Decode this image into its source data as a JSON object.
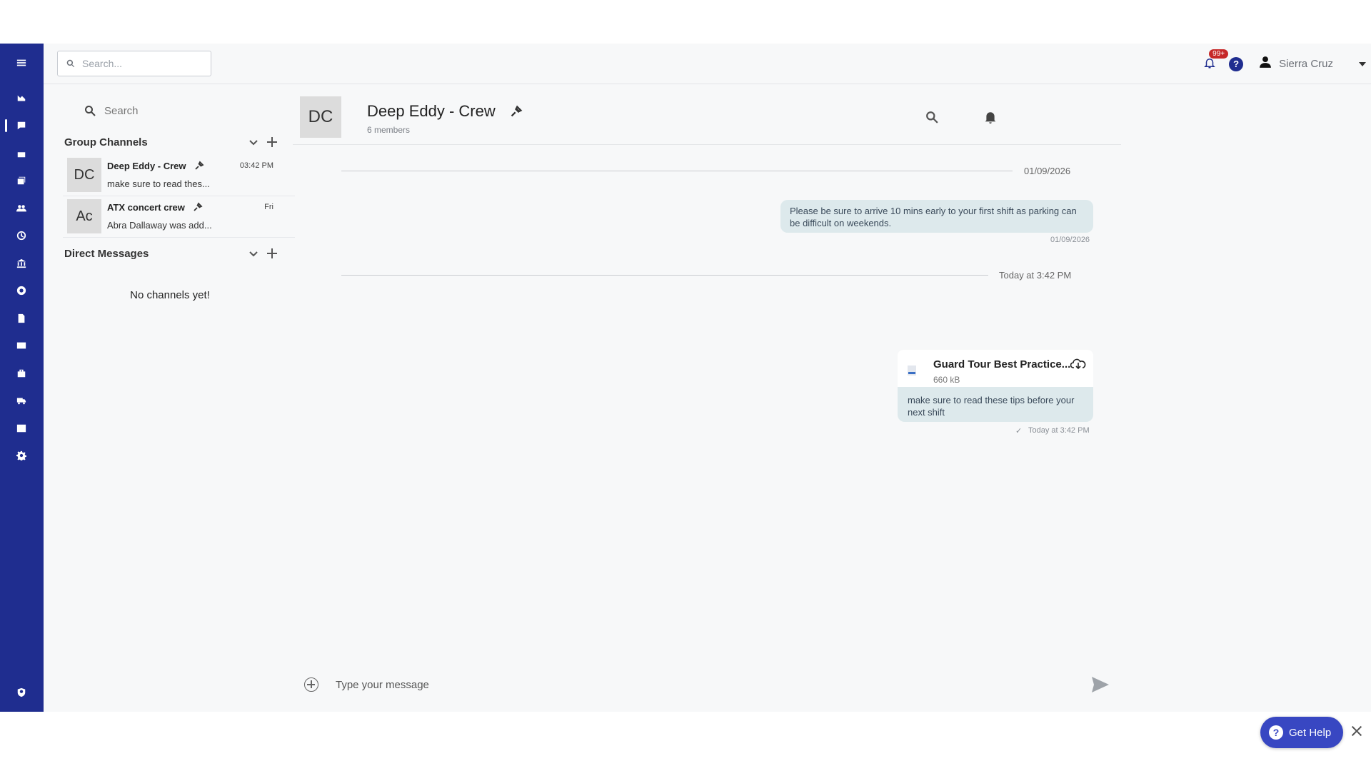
{
  "topbar": {
    "search_placeholder": "Search...",
    "notifications_badge": "99+",
    "help_label": "?",
    "user_name": "Sierra Cruz"
  },
  "rail": {
    "icons": [
      "menu-icon",
      "dashboard-icon",
      "chat-icon",
      "calendar-icon",
      "reports-icon",
      "people-icon",
      "clock-icon",
      "bank-icon",
      "support-icon",
      "document-icon",
      "card-icon",
      "briefcase-icon",
      "vehicle-icon",
      "image-icon",
      "gear-icon",
      "shield-icon"
    ]
  },
  "channels": {
    "search_placeholder": "Search",
    "group_section": "Group Channels",
    "group_items": [
      {
        "avatar": "DC",
        "name": "Deep Eddy - Crew",
        "time": "03:42 PM",
        "preview": "make sure to read thes..."
      },
      {
        "avatar": "Ac",
        "name": "ATX concert crew",
        "time": "Fri",
        "preview": "Abra Dallaway was add..."
      }
    ],
    "dm_section": "Direct Messages",
    "dm_empty": "No channels yet!"
  },
  "conversation": {
    "avatar": "DC",
    "title": "Deep Eddy - Crew",
    "members": "6 members",
    "messages": [
      {
        "divider": "01/09/2026",
        "text": "Please be sure to arrive 10 mins early to your first shift as parking can be difficult on weekends.",
        "timestamp": "01/09/2026"
      },
      {
        "divider": "Today at 3:42 PM",
        "file_name": "Guard Tour Best Practice...",
        "file_size": "660 kB",
        "text": "make sure to read these tips before your next shift",
        "timestamp": "Today at 3:42 PM",
        "read_mark": "✓"
      }
    ]
  },
  "composer": {
    "placeholder": "Type your message"
  },
  "help_widget": {
    "label": "Get Help"
  }
}
